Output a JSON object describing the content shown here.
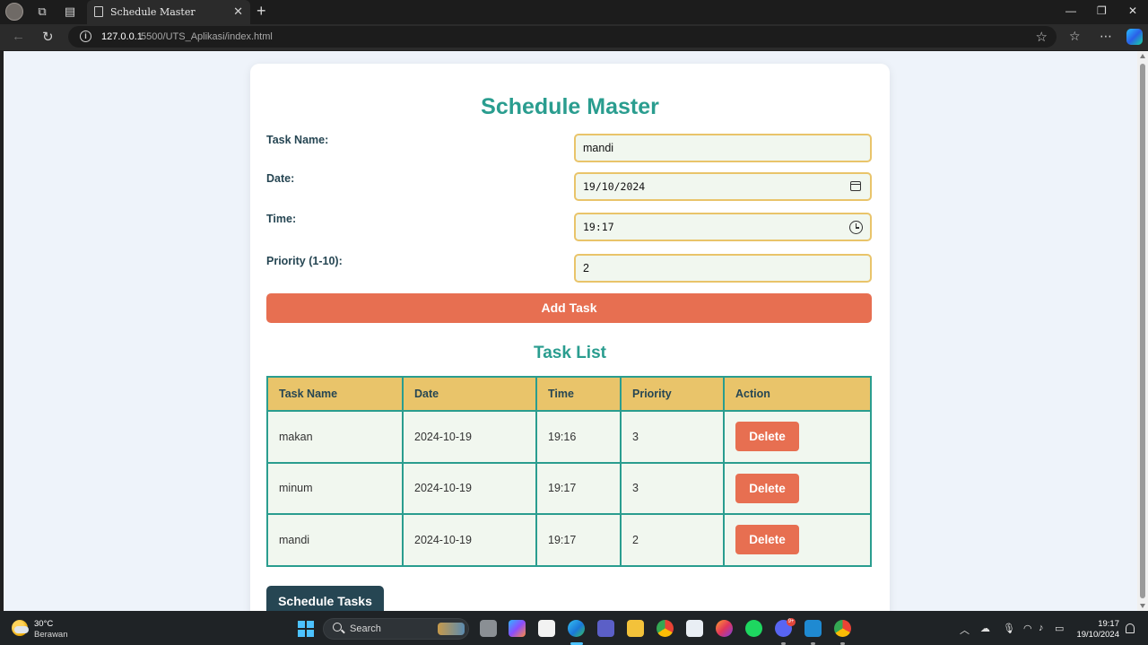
{
  "browser": {
    "tab_title": "Schedule Master",
    "tab_close": "✕",
    "new_tab": "+",
    "url_host": "127.0.0.1",
    "url_path": ":5500/UTS_Aplikasi/index.html",
    "back": "←",
    "reload": "↻",
    "favorite": "☆",
    "favorites_bar": "☆",
    "more": "⋯",
    "minimize": "—",
    "restore": "❐",
    "close": "✕"
  },
  "app": {
    "title": "Schedule Master",
    "form": {
      "task_name_label": "Task Name:",
      "task_name_value": "mandi",
      "date_label": "Date:",
      "date_value": "19/10/2024",
      "time_label": "Time:",
      "time_value": "19:17",
      "priority_label": "Priority (1-10):",
      "priority_value": "2"
    },
    "add_button": "Add Task",
    "list_title": "Task List",
    "table": {
      "headers": [
        "Task Name",
        "Date",
        "Time",
        "Priority",
        "Action"
      ],
      "rows": [
        {
          "name": "makan",
          "date": "2024-10-19",
          "time": "19:16",
          "priority": "3",
          "action": "Delete"
        },
        {
          "name": "minum",
          "date": "2024-10-19",
          "time": "19:17",
          "priority": "3",
          "action": "Delete"
        },
        {
          "name": "mandi",
          "date": "2024-10-19",
          "time": "19:17",
          "priority": "2",
          "action": "Delete"
        }
      ]
    },
    "schedule_button": "Schedule Tasks"
  },
  "taskbar": {
    "weather_temp": "30°C",
    "weather_desc": "Berawan",
    "search_placeholder": "Search",
    "notification_badge": "9+",
    "time": "19:17",
    "date": "19/10/2024"
  },
  "colors": {
    "accent_teal": "#2a9d8f",
    "button_coral": "#e76f51",
    "header_gold": "#e9c46a",
    "dark_slate": "#264653"
  }
}
